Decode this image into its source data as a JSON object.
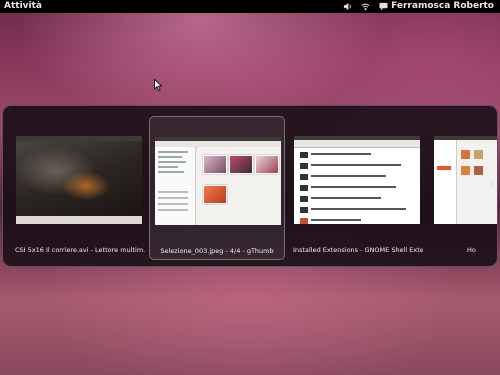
{
  "topbar": {
    "activities_label": "Attività",
    "user_name": "Ferramosca Roberto",
    "icons": [
      "volume-icon",
      "network-icon",
      "chat-icon"
    ]
  },
  "switcher": {
    "windows": [
      {
        "caption": "CSI 5x16 Il corriere.avi - Lettore multim...",
        "selected": false,
        "icon": "video-player-window"
      },
      {
        "caption": "Selezione_003.jpeg - 4/4 - gThumb",
        "selected": true,
        "icon": "image-viewer-window"
      },
      {
        "caption": "Installed Extensions - GNOME Shell Exte...",
        "selected": false,
        "icon": "browser-window"
      },
      {
        "caption": "Ho",
        "selected": false,
        "icon": "file-manager-window"
      }
    ]
  },
  "colors": {
    "topbar": "#000000",
    "switcher_bg": "#160e14",
    "wallpaper_primary": "#8c3a5c"
  }
}
